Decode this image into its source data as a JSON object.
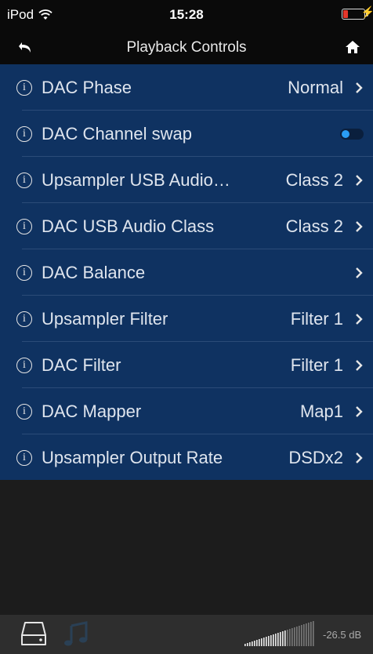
{
  "status_bar": {
    "carrier": "iPod",
    "time": "15:28",
    "charge_symbol": "⚡"
  },
  "nav": {
    "title": "Playback Controls",
    "back_icon": "back-arrow-icon",
    "home_icon": "home-icon"
  },
  "settings": [
    {
      "label": "DAC Phase",
      "value": "Normal",
      "control": "chevron"
    },
    {
      "label": "DAC Channel swap",
      "value": "",
      "control": "toggle",
      "toggle_on": false
    },
    {
      "label": "Upsampler USB Audio…",
      "value": "Class 2",
      "control": "chevron"
    },
    {
      "label": "DAC USB Audio Class",
      "value": "Class 2",
      "control": "chevron"
    },
    {
      "label": "DAC Balance",
      "value": "",
      "control": "chevron"
    },
    {
      "label": "Upsampler Filter",
      "value": "Filter 1",
      "control": "chevron"
    },
    {
      "label": "DAC Filter",
      "value": "Filter 1",
      "control": "chevron"
    },
    {
      "label": "DAC Mapper",
      "value": "Map1",
      "control": "chevron"
    },
    {
      "label": "Upsampler Output Rate",
      "value": "DSDx2",
      "control": "chevron"
    }
  ],
  "info_icon": {
    "glyph": "i",
    "name": "info-icon"
  },
  "bottom_bar": {
    "device_icon": "hard-drive-icon",
    "music_icon": "music-note-icon",
    "volume_level": 0.6,
    "volume_db": "-26.5 dB"
  },
  "colors": {
    "list_background": "#0f3261",
    "toggle_knob": "#2a9df4",
    "battery_low": "#e5372b"
  }
}
